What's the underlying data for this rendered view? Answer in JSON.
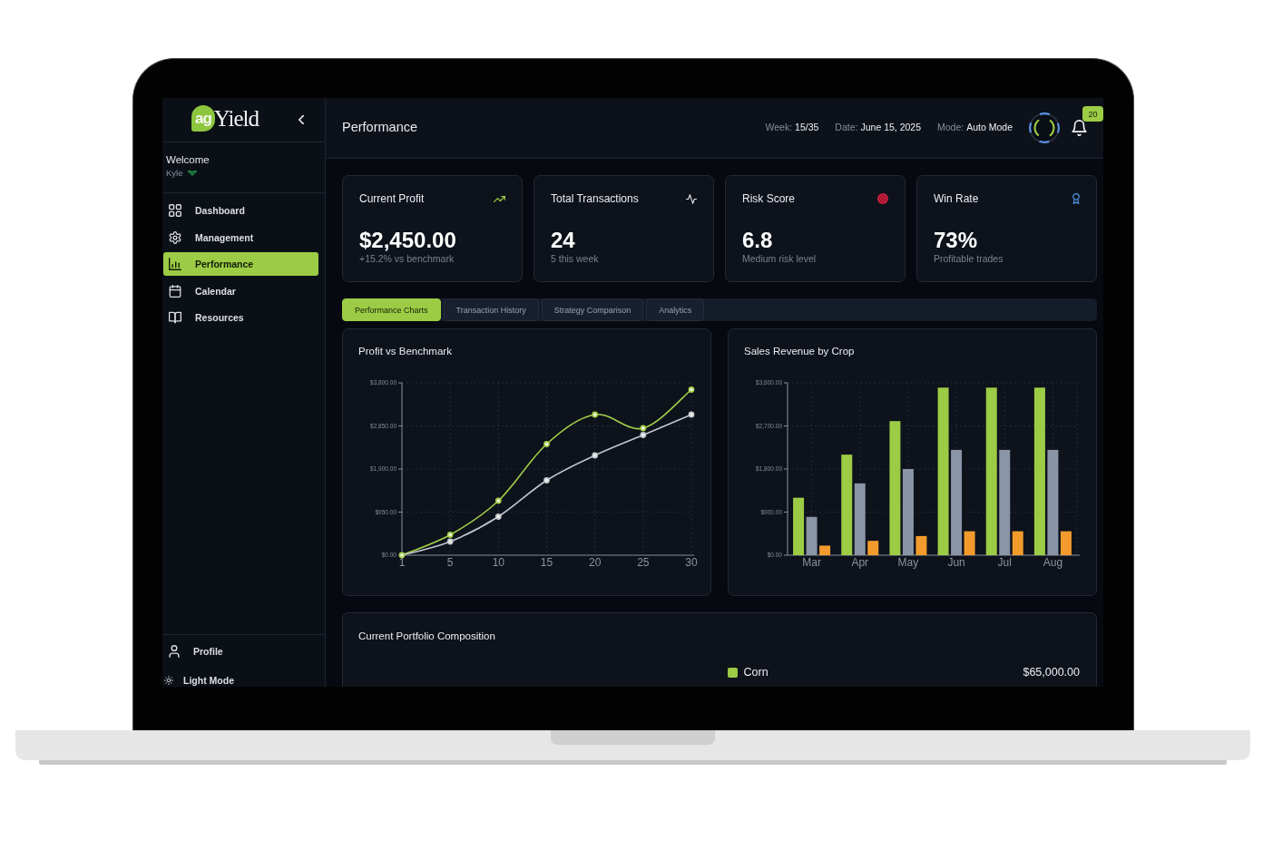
{
  "logo": {
    "mark": "ag",
    "name": "Yield"
  },
  "sidebar": {
    "welcome": "Welcome",
    "user": "Kyle",
    "items": [
      {
        "label": "Dashboard",
        "selected": false
      },
      {
        "label": "Management",
        "selected": false
      },
      {
        "label": "Performance",
        "selected": true
      },
      {
        "label": "Calendar",
        "selected": false
      },
      {
        "label": "Resources",
        "selected": false
      }
    ],
    "profile": {
      "label": "Profile"
    },
    "theme_toggle": {
      "label": "Light Mode"
    }
  },
  "header": {
    "title": "Performance",
    "stats": [
      {
        "label": "Week:",
        "value": "15/35"
      },
      {
        "label": "Date:",
        "value": "June 15, 2025"
      },
      {
        "label": "Mode:",
        "value": "Auto Mode"
      }
    ],
    "notifications": {
      "count": "20"
    }
  },
  "cards": [
    {
      "title": "Current Profit",
      "value": "$2,450.00",
      "note": "+15.2% vs benchmark"
    },
    {
      "title": "Total Transactions",
      "value": "24",
      "note": "5 this week"
    },
    {
      "title": "Risk Score",
      "value": "6.8",
      "note": "Medium risk level"
    },
    {
      "title": "Win Rate",
      "value": "73%",
      "note": "Profitable trades"
    }
  ],
  "tabs": [
    {
      "label": "Performance Charts",
      "selected": true
    },
    {
      "label": "Transaction History",
      "selected": false
    },
    {
      "label": "Strategy Comparison",
      "selected": false
    },
    {
      "label": "Analytics",
      "selected": false
    }
  ],
  "charts": [
    {
      "chart_data": {
        "type": "line",
        "title": "Profit vs Benchmark",
        "categories": [
          "1",
          "5",
          "10",
          "15",
          "20",
          "25",
          "30"
        ],
        "ylim": [
          0,
          3800
        ],
        "yticks": [
          {
            "value": 0,
            "label": "$0.00"
          },
          {
            "value": 950,
            "label": "$950.00"
          },
          {
            "value": 1900,
            "label": "$1,900.00"
          },
          {
            "value": 2850,
            "label": "$2,850.00"
          },
          {
            "value": 3800,
            "label": "$3,800.00"
          }
        ],
        "grid": true,
        "marker": "circle",
        "series": [
          {
            "color": "#a2cf48",
            "values": [
              0,
              450,
              1200,
              2450,
              3100,
              2800,
              3650
            ]
          },
          {
            "color": "#c3c7d1",
            "values": [
              0,
              300,
              850,
              1650,
              2200,
              2650,
              3100
            ]
          }
        ]
      }
    },
    {
      "chart_data": {
        "type": "bar",
        "title": "Sales Revenue by Crop",
        "categories": [
          "Mar",
          "Apr",
          "May",
          "Jun",
          "Jul",
          "Aug"
        ],
        "ylim": [
          0,
          3600
        ],
        "yticks": [
          {
            "value": 0,
            "label": "$0.00"
          },
          {
            "value": 900,
            "label": "$900.00"
          },
          {
            "value": 1800,
            "label": "$1,800.00"
          },
          {
            "value": 2700,
            "label": "$2,700.00"
          },
          {
            "value": 3600,
            "label": "$3,600.00"
          }
        ],
        "grid": true,
        "series": [
          {
            "color": "#9ccc45",
            "values": [
              1200,
              2100,
              2800,
              3500,
              3500,
              3500
            ]
          },
          {
            "color": "#8b95a8",
            "values": [
              800,
              1500,
              1800,
              2200,
              2200,
              2200
            ]
          },
          {
            "color": "#f29b2c",
            "values": [
              200,
              300,
              400,
              500,
              500,
              500
            ]
          }
        ]
      }
    }
  ],
  "portfolio": {
    "title": "Current Portfolio Composition",
    "items": [
      {
        "label": "Corn",
        "value": "$65,000.00",
        "color": "#9ccc45"
      }
    ]
  }
}
